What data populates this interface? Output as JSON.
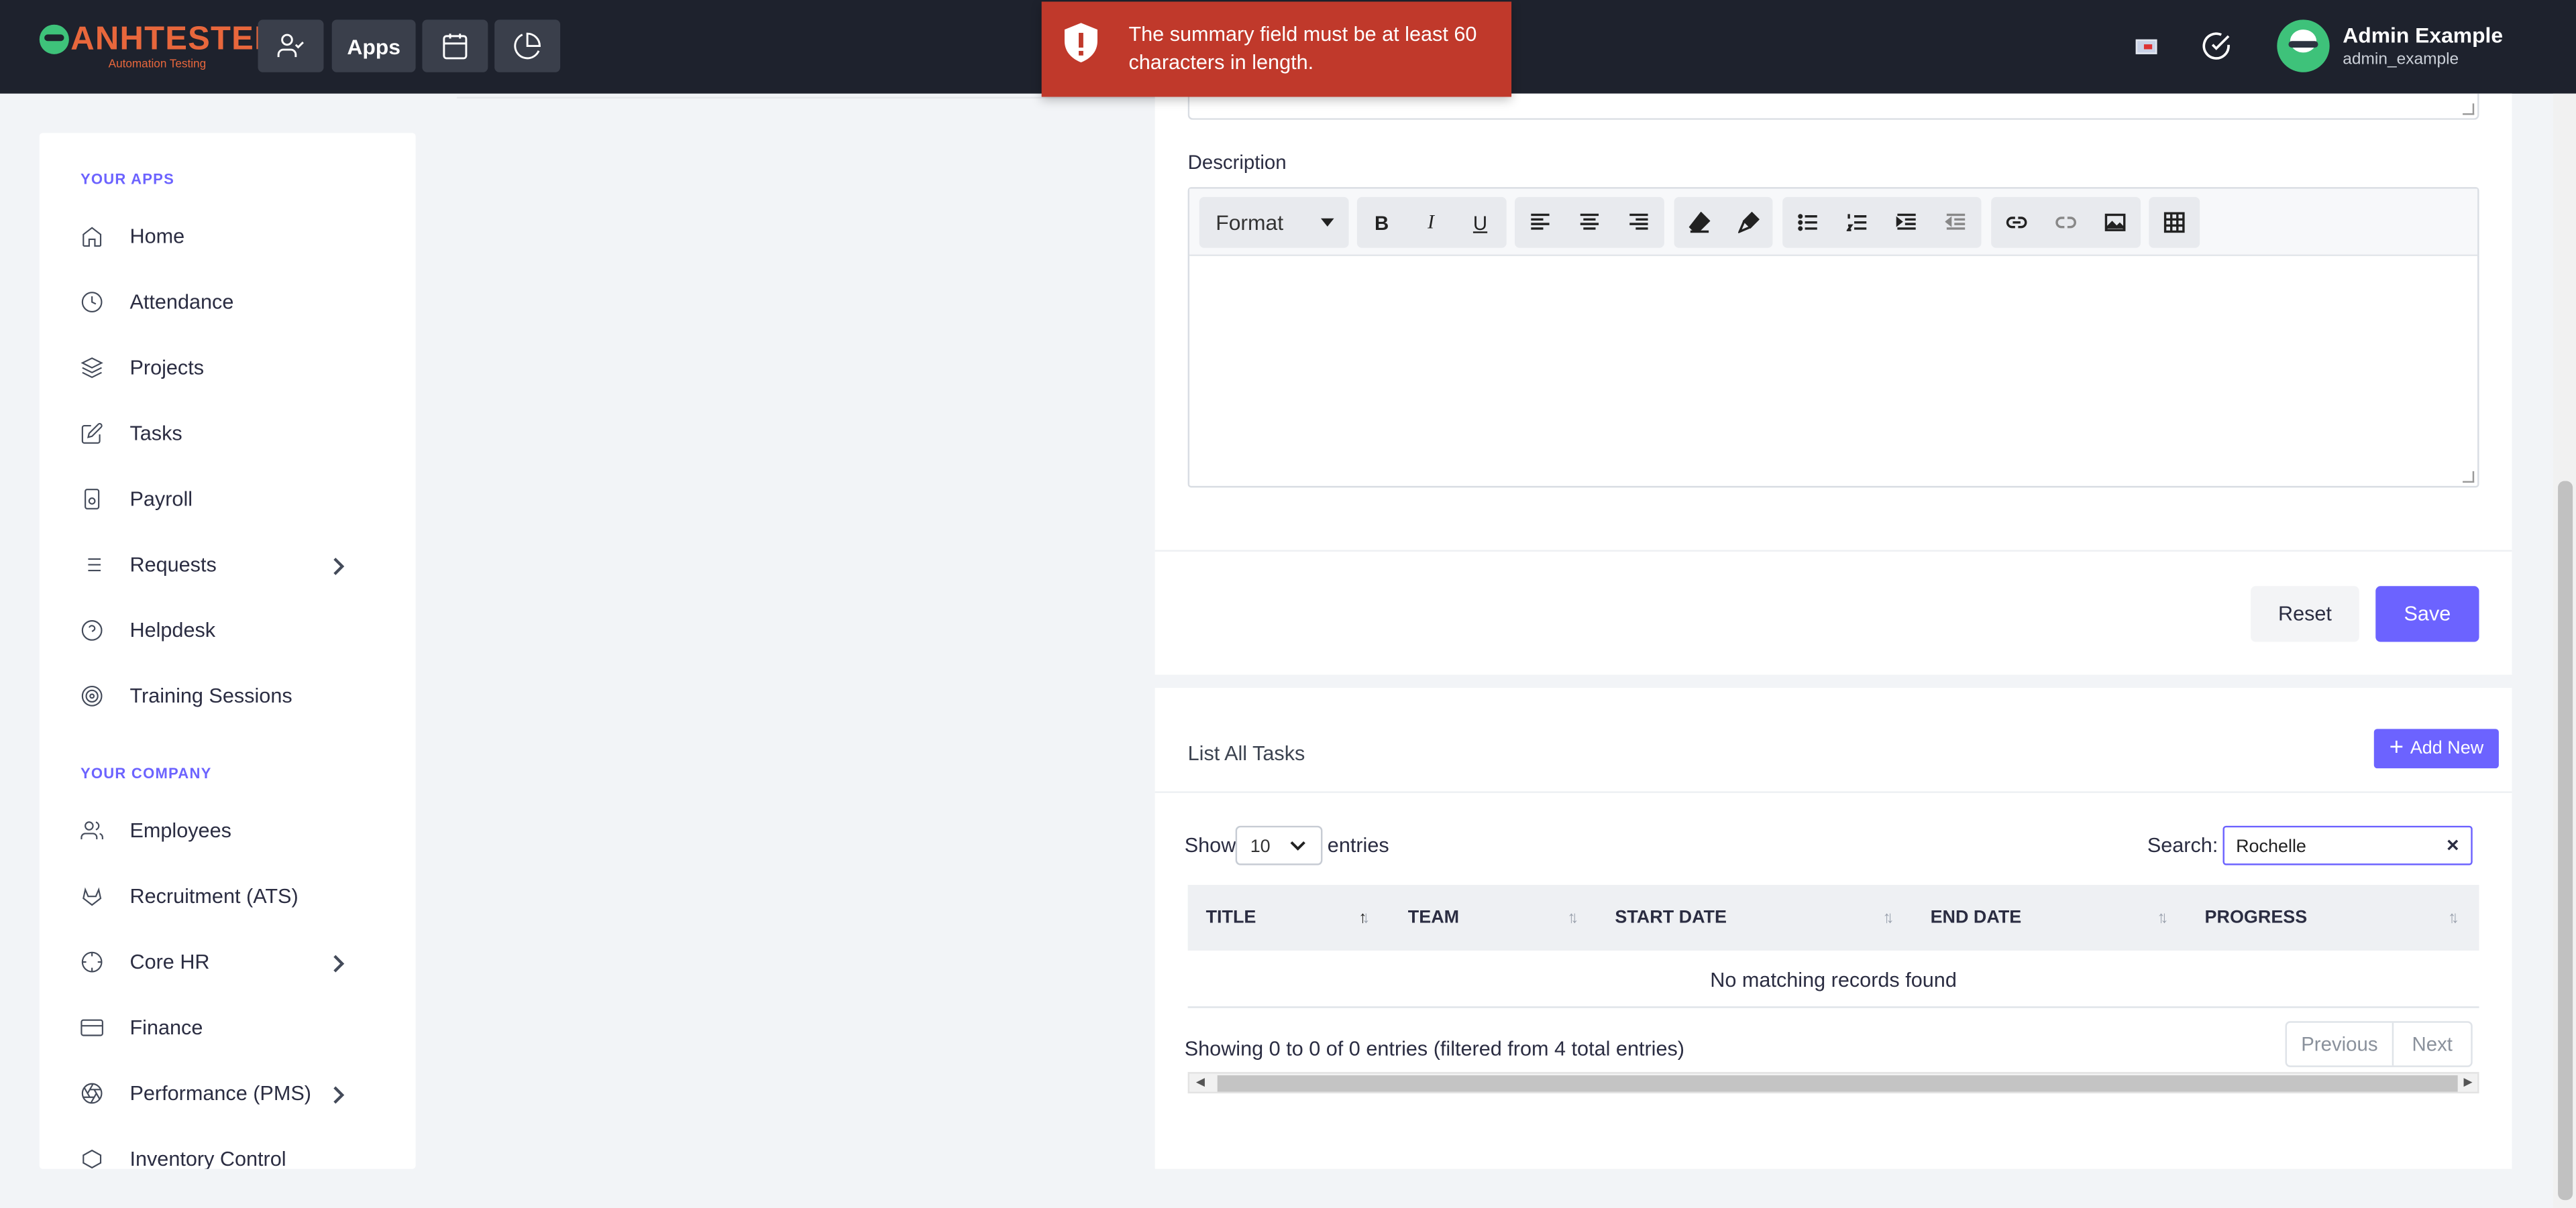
{
  "app": {
    "logo_text": "ANHTESTER",
    "logo_subtitle": "Automation Testing",
    "nav_apps_label": "Apps"
  },
  "toast": {
    "message": "The summary field must be at least 60 characters in length.",
    "color": "#c0392b"
  },
  "user": {
    "name": "Admin Example",
    "username": "admin_example"
  },
  "sidebar": {
    "section_apps": "YOUR APPS",
    "apps": [
      {
        "label": "Home",
        "icon": "home-icon"
      },
      {
        "label": "Attendance",
        "icon": "clock-icon"
      },
      {
        "label": "Projects",
        "icon": "layers-icon"
      },
      {
        "label": "Tasks",
        "icon": "edit-icon"
      },
      {
        "label": "Payroll",
        "icon": "payroll-icon"
      },
      {
        "label": "Requests",
        "icon": "list-icon",
        "has_submenu": true
      },
      {
        "label": "Helpdesk",
        "icon": "help-circle-icon"
      },
      {
        "label": "Training Sessions",
        "icon": "target-icon"
      }
    ],
    "section_company": "YOUR COMPANY",
    "company": [
      {
        "label": "Employees",
        "icon": "users-icon"
      },
      {
        "label": "Recruitment (ATS)",
        "icon": "gitlab-icon"
      },
      {
        "label": "Core HR",
        "icon": "crosshair-icon",
        "has_submenu": true
      },
      {
        "label": "Finance",
        "icon": "credit-card-icon"
      },
      {
        "label": "Performance (PMS)",
        "icon": "aperture-icon",
        "has_submenu": true
      },
      {
        "label": "Inventory Control",
        "icon": "box-icon"
      }
    ]
  },
  "form": {
    "description_label": "Description",
    "format_label": "Format",
    "reset_label": "Reset",
    "save_label": "Save"
  },
  "tasks_list": {
    "title": "List All Tasks",
    "add_new_label": "Add New",
    "show_label": "Show",
    "page_length": "10",
    "entries_label": "entries",
    "search_label": "Search:",
    "search_value": "Rochelle",
    "columns": [
      "TITLE",
      "TEAM",
      "START DATE",
      "END DATE",
      "PROGRESS"
    ],
    "empty_message": "No matching records found",
    "info": "Showing 0 to 0 of 0 entries (filtered from 4 total entries)",
    "previous_label": "Previous",
    "next_label": "Next"
  },
  "colors": {
    "accent": "#6c63ff",
    "topbar": "#1e222d",
    "brand": "#e8673c"
  }
}
